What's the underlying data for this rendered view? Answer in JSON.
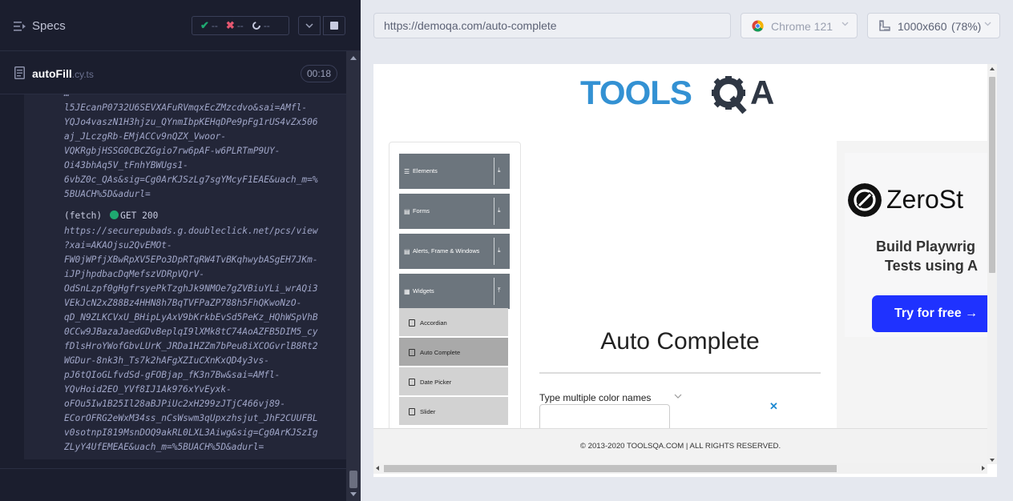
{
  "reporter": {
    "specs_label": "Specs",
    "stats": {
      "passed_symbol": "✔",
      "passed_count": "--",
      "failed_symbol": "✖",
      "failed_count": "--",
      "pending_count": "--"
    },
    "test": {
      "name": "autoFill",
      "ext": ".cy.ts",
      "duration": "00:18"
    },
    "log_lines_a": [
      "l5JEcanP0732U6SEVXAFuRVmqxEcZMzcdvo&sai=AMfl-",
      "YQJo4vaszN1H3hjzu_QYnmIbpKEHqDPe9pFg1rUS4vZx506",
      "aj_JLczgRb-EMjACCv9nQZX_Vwoor-",
      "VQKRgbjHSSG0CBCZGgio7rw6pAF-w6PLRTmP9UY-",
      "Oi43bhAq5V_tFnhYBWUgs1-",
      "6vbZ0c_QAs&sig=Cg0ArKJSzLg7sgYMcyF1EAE&uach_m=%",
      "5BUACH%5D&adurl="
    ],
    "fetch_cmd": {
      "label": "(fetch)",
      "method_status": "GET 200"
    },
    "log_lines_b": [
      "https://securepubads.g.doubleclick.net/pcs/view",
      "?xai=AKAOjsu2QvEMOt-",
      "FW0jWPfjXBwRpXV5EPo3DpRTqRW4TvBKqhwybASgEH7JKm-",
      "iJPjhpdbacDqMefszVDRpVQrV-",
      "OdSnLzpf0gHgfrsyePkTzghJk9NMOe7gZVBiuYLi_wrAQi3",
      "VEkJcN2xZ88Bz4HHN8h7BqTVFPaZP788h5FhQKwoNzO-",
      "qD_N9ZLKCVxU_BHipLyAxV9bKrkbEvSd5PeKz_HQhWSpVhB",
      "0CCw9JBazaJaedGDvBeplqI9lXMk8tC74AoAZFB5DIM5_cy",
      "fDlsHroYWofGbvLUrK_JRDa1HZZm7bPeu8iXCOGvrlB8Rt2",
      "WGDur-8nk3h_Ts7k2hAFgXZIuCXnKxQD4y3vs-",
      "pJ6tQIoGLfvdSd-gFOBjap_fK3n7Bw&sai=AMfl-",
      "YQvHoid2EO_YVf8IJ1Ak976xYvEyxk-",
      "oFOu5Iw1B25Il28aBJPiUc2xH299zJTjC466vj89-",
      "ECorOFRG2eWxM34ss_nCsWswm3qUpxzhsjut_JhF2CUUFBL",
      "v0sotnpI819MsnDOQ9akRL0LXL3Aiwg&sig=Cg0ArKJSzIg",
      "ZLyY4UfEMEAE&uach_m=%5BUACH%5D&adurl="
    ]
  },
  "aut": {
    "url": "https://demoqa.com/auto-complete",
    "browser": "Chrome 121",
    "viewport": "1000x660",
    "zoom": "(78%)"
  },
  "page": {
    "logo_text_left": "TOOLS",
    "logo_text_right": "A",
    "sidebar_groups": [
      {
        "label": "Elements",
        "icon": "☰",
        "arrow": "⤓"
      },
      {
        "label": "Forms",
        "icon": "▤",
        "arrow": "⤓"
      },
      {
        "label": "Alerts, Frame & Windows",
        "icon": "▤",
        "arrow": "⤓"
      },
      {
        "label": "Widgets",
        "icon": "▦",
        "arrow": "⤒"
      }
    ],
    "sidebar_items": [
      {
        "label": "Accordian"
      },
      {
        "label": "Auto Complete"
      },
      {
        "label": "Date Picker"
      },
      {
        "label": "Slider"
      }
    ],
    "title": "Auto Complete",
    "multi_label": "Type multiple color names",
    "clear_symbol": "✕",
    "ad": {
      "brand": "ZeroSt",
      "line1": "Build Playwrig",
      "line2": "Tests using A",
      "cta": "Try for free →"
    },
    "footer": "© 2013-2020 TOOLSQA.COM | ALL RIGHTS RESERVED."
  },
  "colors": {
    "reporter_bg": "#1b1e2e",
    "pass_green": "#1fa971",
    "fail_red": "#e45770",
    "sidebar_group_bg": "#6c757d",
    "active_item_bg": "#a9a9a9",
    "logo_blue": "#3391d3",
    "ad_button_blue": "#1f32ff"
  },
  "icons": [
    "list-icon",
    "check-icon",
    "cross-icon",
    "spinner-icon",
    "chevron-down-icon",
    "stop-icon",
    "document-icon",
    "chrome-icon",
    "ruler-icon"
  ]
}
